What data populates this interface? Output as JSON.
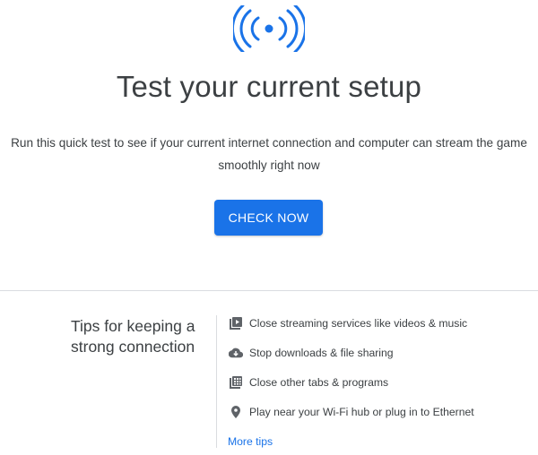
{
  "header": {
    "icon": "broadcast-signal-icon",
    "title": "Test your current setup",
    "description": "Run this quick test to see if your current internet connection and computer can stream the game smoothly right now",
    "check_button_label": "CHECK NOW"
  },
  "tips": {
    "heading": "Tips for keeping a strong connection",
    "items": [
      {
        "icon": "video-library-icon",
        "label": "Close streaming services like videos & music"
      },
      {
        "icon": "cloud-download-icon",
        "label": "Stop downloads & file sharing"
      },
      {
        "icon": "grid-tabs-icon",
        "label": "Close other tabs & programs"
      },
      {
        "icon": "location-pin-icon",
        "label": "Play near your Wi-Fi hub or plug in to Ethernet"
      }
    ],
    "more_tips_label": "More tips"
  },
  "colors": {
    "accent": "#1a73e8",
    "text": "#3c4043",
    "icon_gray": "#5f6368",
    "divider": "#dadce0"
  }
}
